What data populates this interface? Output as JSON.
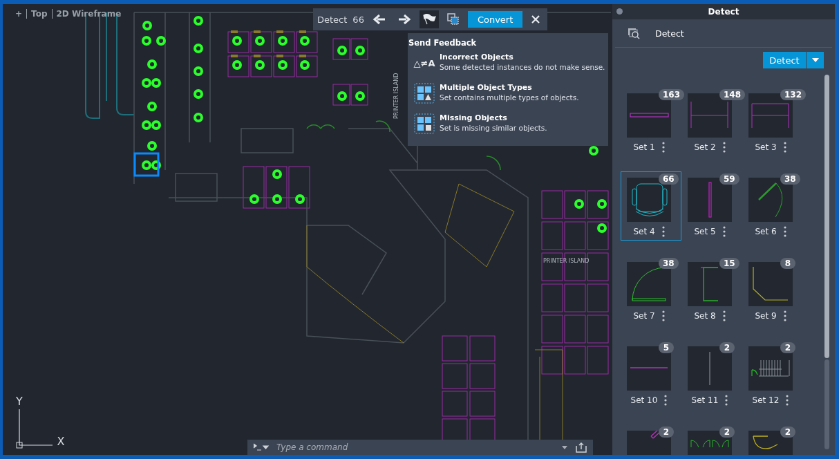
{
  "viewport": {
    "items": [
      "+",
      "Top",
      "2D Wireframe"
    ]
  },
  "toolbar": {
    "title": "Detect",
    "count": "66",
    "flag_selected": true,
    "convert_label": "Convert"
  },
  "feedback_menu": {
    "title": "Send Feedback",
    "items": [
      {
        "kind": "incorrect",
        "glyph": "△≠A",
        "title": "Incorrect Objects",
        "description": "Some detected instances do not make sense."
      },
      {
        "kind": "multiple",
        "title": "Multiple Object Types",
        "description": "Set contains multiple types of objects."
      },
      {
        "kind": "missing",
        "title": "Missing Objects",
        "description": "Set is missing similar objects."
      }
    ]
  },
  "floor_plan": {
    "labels": [
      "PRINTER ISLAND",
      "PRINTER ISLAND"
    ]
  },
  "ucs": {
    "y_label": "Y",
    "x_label": "X"
  },
  "command_line": {
    "placeholder": "Type a command"
  },
  "panel": {
    "title": "Detect",
    "header": "Detect",
    "detect_button": "Detect",
    "sets": [
      {
        "label": "Set 1",
        "count": "163",
        "kind": "bar",
        "selected": false
      },
      {
        "label": "Set 2",
        "count": "148",
        "kind": "h-frame",
        "selected": false
      },
      {
        "label": "Set 3",
        "count": "132",
        "kind": "table-frame",
        "selected": false
      },
      {
        "label": "Set 4",
        "count": "66",
        "kind": "chair",
        "selected": true
      },
      {
        "label": "Set 5",
        "count": "59",
        "kind": "post",
        "selected": false
      },
      {
        "label": "Set 6",
        "count": "38",
        "kind": "door-swing",
        "selected": false
      },
      {
        "label": "Set 7",
        "count": "38",
        "kind": "door-arc",
        "selected": false
      },
      {
        "label": "Set 8",
        "count": "15",
        "kind": "bracket",
        "selected": false
      },
      {
        "label": "Set 9",
        "count": "8",
        "kind": "corner",
        "selected": false
      },
      {
        "label": "Set 10",
        "count": "5",
        "kind": "line",
        "selected": false
      },
      {
        "label": "Set 11",
        "count": "2",
        "kind": "thin-line",
        "selected": false
      },
      {
        "label": "Set 12",
        "count": "2",
        "kind": "stair",
        "selected": false
      },
      {
        "count": "2",
        "kind": "diagonal",
        "selected": false
      },
      {
        "count": "2",
        "kind": "double-door",
        "selected": false
      },
      {
        "count": "2",
        "kind": "arc-door",
        "selected": false
      }
    ]
  }
}
